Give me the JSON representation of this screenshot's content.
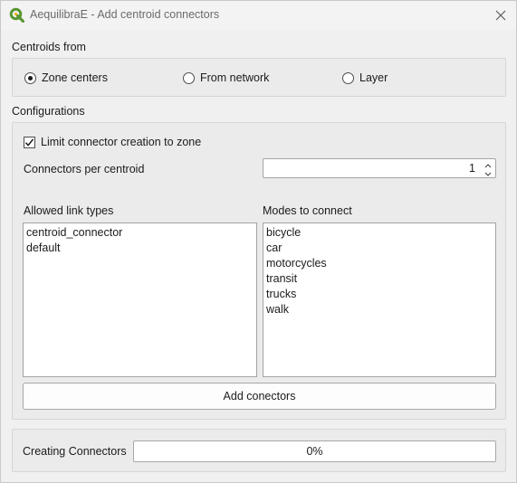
{
  "window": {
    "title": "AequilibraE - Add centroid connectors"
  },
  "centroids_from": {
    "label": "Centroids from",
    "options": [
      {
        "label": "Zone centers",
        "checked": true
      },
      {
        "label": "From network",
        "checked": false
      },
      {
        "label": "Layer",
        "checked": false
      }
    ]
  },
  "configurations": {
    "label": "Configurations",
    "limit_zone": {
      "label": "Limit connector creation to zone",
      "checked": true
    },
    "connectors_per_centroid": {
      "label": "Connectors per centroid",
      "value": "1"
    },
    "allowed_link_types": {
      "label": "Allowed link types",
      "items": [
        "centroid_connector",
        "default"
      ]
    },
    "modes_to_connect": {
      "label": "Modes to connect",
      "items": [
        "bicycle",
        "car",
        "motorcycles",
        "transit",
        "trucks",
        "walk"
      ]
    },
    "add_button": {
      "label": "Add conectors"
    }
  },
  "progress": {
    "label": "Creating Connectors",
    "text": "0%",
    "value": 0
  },
  "colors": {
    "qgis_green": "#589632",
    "qgis_yellow": "#f0b31b",
    "progress_blue": "#3c9ee8"
  }
}
